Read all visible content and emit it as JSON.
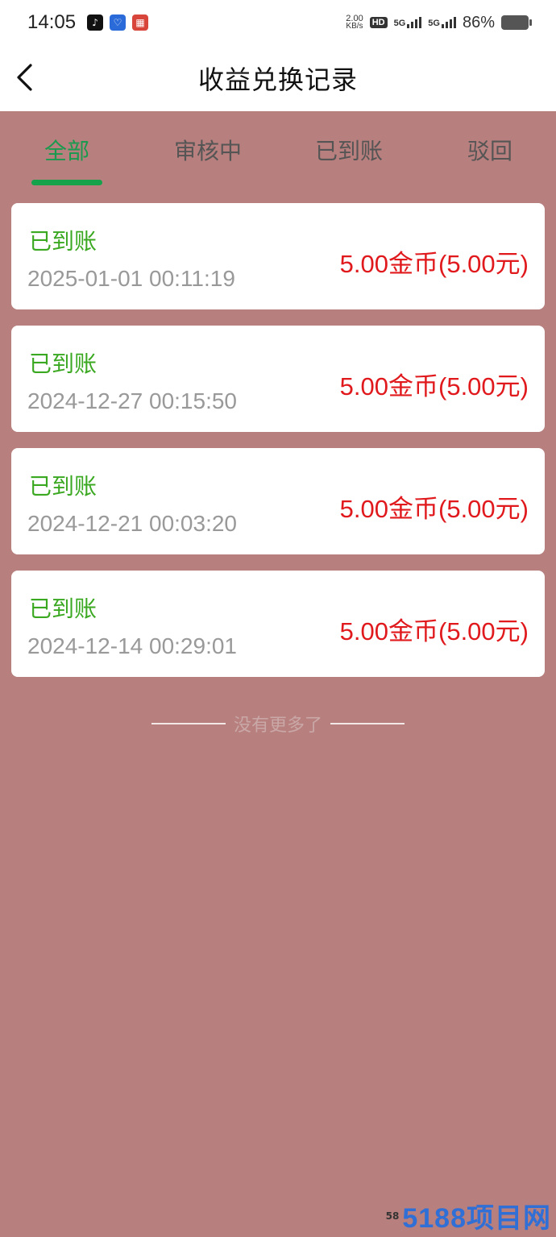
{
  "status_bar": {
    "time": "14:05",
    "speed_value": "2.00",
    "speed_unit": "KB/s",
    "hd_label": "HD",
    "signal_1": "5G",
    "signal_2": "5G",
    "battery": "86%"
  },
  "header": {
    "title": "收益兑换记录"
  },
  "tabs": [
    {
      "label": "全部",
      "active": true
    },
    {
      "label": "审核中",
      "active": false
    },
    {
      "label": "已到账",
      "active": false
    },
    {
      "label": "驳回",
      "active": false
    }
  ],
  "records": [
    {
      "status": "已到账",
      "time": "2025-01-01 00:11:19",
      "amount": "5.00金币(5.00元)"
    },
    {
      "status": "已到账",
      "time": "2024-12-27 00:15:50",
      "amount": "5.00金币(5.00元)"
    },
    {
      "status": "已到账",
      "time": "2024-12-21 00:03:20",
      "amount": "5.00金币(5.00元)"
    },
    {
      "status": "已到账",
      "time": "2024-12-14 00:29:01",
      "amount": "5.00金币(5.00元)"
    }
  ],
  "footer": {
    "no_more": "没有更多了"
  },
  "watermark": {
    "small": "58",
    "big": "5188项目网"
  },
  "colors": {
    "background": "#b77f7d",
    "active_tab": "#1a9a4e",
    "status_green": "#3aa821",
    "amount_red": "#e0191d"
  }
}
